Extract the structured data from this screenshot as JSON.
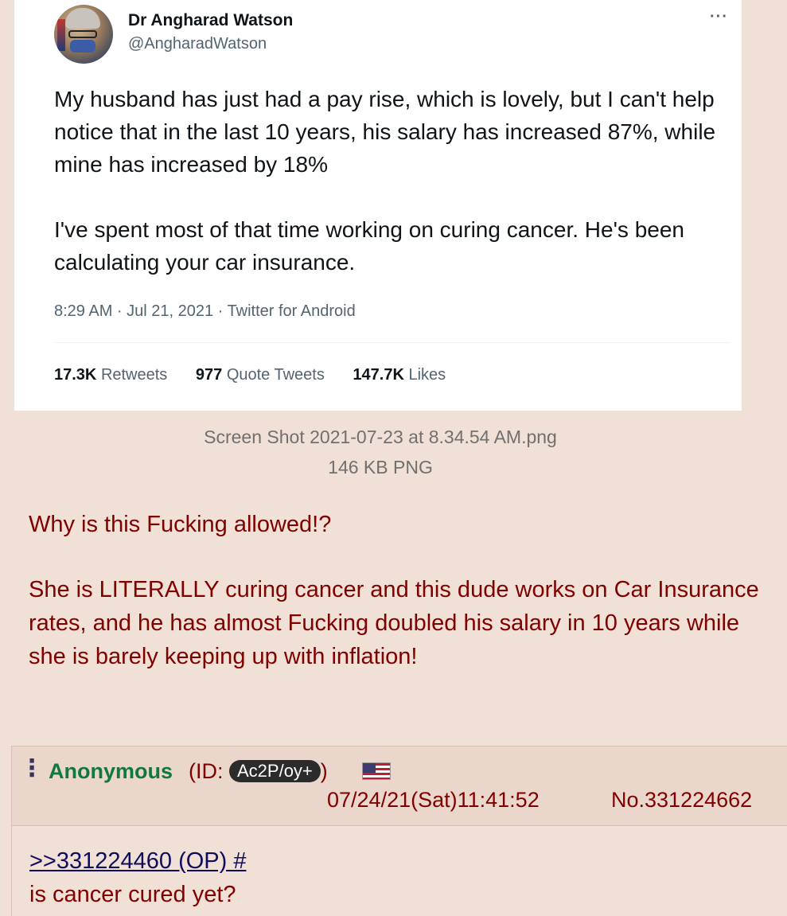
{
  "tweet": {
    "display_name": "Dr Angharad Watson",
    "handle": "@AngharadWatson",
    "more_icon": "more-horizontal-icon",
    "paragraphs": [
      "My husband has just had a pay rise, which is lovely, but I can't help notice that in the last 10 years, his salary has increased 87%, while mine has increased by 18%",
      "I've spent most of that time working on curing cancer. He's been calculating your car insurance."
    ],
    "meta": "8:29 AM · Jul 21, 2021 · Twitter for Android",
    "stats": {
      "retweets_count": "17.3K",
      "retweets_label": "Retweets",
      "quotes_count": "977",
      "quotes_label": "Quote Tweets",
      "likes_count": "147.7K",
      "likes_label": "Likes"
    }
  },
  "file": {
    "name": "Screen Shot 2021-07-23 at 8.34.54 AM.png",
    "info": "146 KB PNG"
  },
  "op": {
    "paragraphs": [
      "Why is this Fucking allowed!?",
      "She is LITERALLY curing cancer and this dude works on Car Insurance rates, and he has almost Fucking doubled his salary in 10 years while she is barely keeping up with inflation!"
    ]
  },
  "reply": {
    "menu_icon": "vertical-dots-icon",
    "name": "Anonymous",
    "id_prefix": "(ID: ",
    "id": "Ac2P/oy+",
    "id_suffix": ")",
    "flag_icon": "us-flag-icon",
    "datetime": "07/24/21(Sat)11:41:52",
    "post_number": "No.331224662",
    "quote_link": ">>331224460 (OP) #",
    "text": "is cancer cured yet?"
  },
  "colors": {
    "board_bg": "#f0e0d6",
    "post_text": "#800000",
    "name_green": "#117743",
    "link_blue": "#0f0c5d",
    "tweet_bg": "#ffffff"
  }
}
